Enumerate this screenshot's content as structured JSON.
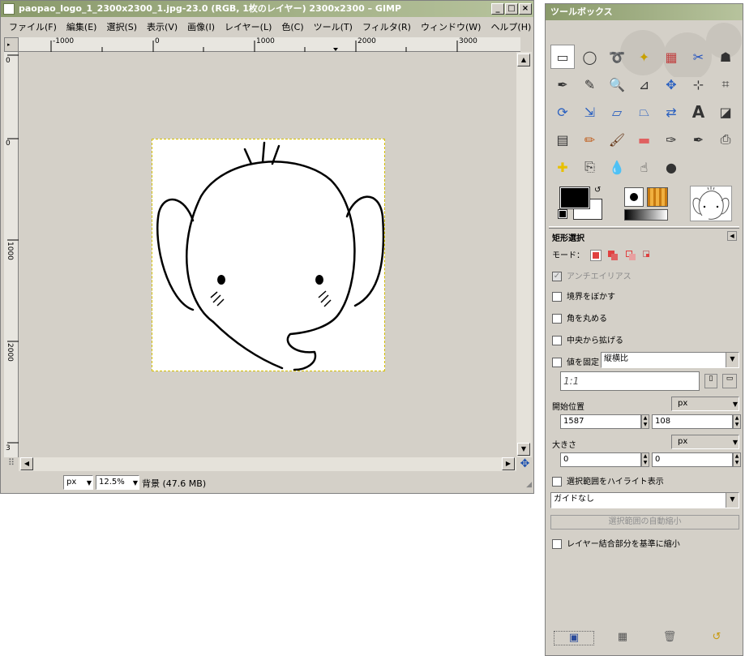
{
  "image_window": {
    "title": "paopao_logo_1_2300x2300_1.jpg-23.0 (RGB, 1枚のレイヤー) 2300x2300 – GIMP",
    "buttons": {
      "minimize": "_",
      "maximize": "□",
      "close": "×"
    },
    "menu": [
      "ファイル(F)",
      "編集(E)",
      "選択(S)",
      "表示(V)",
      "画像(I)",
      "レイヤー(L)",
      "色(C)",
      "ツール(T)",
      "フィルタ(R)",
      "ウィンドウ(W)",
      "ヘルプ(H)"
    ],
    "hruler_labels": [
      "-1000",
      "0",
      "1000",
      "2000",
      "3000"
    ],
    "vruler_labels": [
      "0",
      "0",
      "1000",
      "2000",
      "3"
    ],
    "status": {
      "unit": "px",
      "zoom": "12.5%",
      "layer_info": "背景 (47.6 MB)"
    }
  },
  "toolbox": {
    "title": "ツールボックス",
    "icons": [
      "rect-select-icon",
      "ellipse-select-icon",
      "free-select-icon",
      "fuzzy-select-icon",
      "color-select-icon",
      "scissors-icon",
      "foreground-select-icon",
      "paths-icon",
      "color-picker-icon",
      "zoom-icon",
      "measure-icon",
      "move-icon",
      "align-icon",
      "crop-icon",
      "rotate-icon",
      "scale-icon",
      "shear-icon",
      "perspective-icon",
      "flip-icon",
      "text-icon",
      "bucket-fill-icon",
      "blend-icon",
      "pencil-icon",
      "paintbrush-icon",
      "eraser-icon",
      "airbrush-icon",
      "ink-icon",
      "clone-icon",
      "heal-icon",
      "perspective-clone-icon",
      "blur-icon",
      "smudge-icon",
      "dodge-burn-icon"
    ],
    "options": {
      "title": "矩形選択",
      "mode_label": "モード：",
      "antialias": "アンチエイリアス",
      "feather": "境界をぼかす",
      "rounded": "角を丸める",
      "expand_center": "中央から拡げる",
      "fixed": "値を固定",
      "fixed_mode": "縦横比",
      "ratio": "1:1",
      "position_label": "開始位置",
      "position_unit": "px",
      "pos_x": "1587",
      "pos_y": "108",
      "size_label": "大きさ",
      "size_unit": "px",
      "size_w": "0",
      "size_h": "0",
      "highlight": "選択範囲をハイライト表示",
      "guides": "ガイドなし",
      "auto_shrink": "選択範囲の自動縮小",
      "shrink_merged": "レイヤー結合部分を基準に縮小"
    }
  }
}
